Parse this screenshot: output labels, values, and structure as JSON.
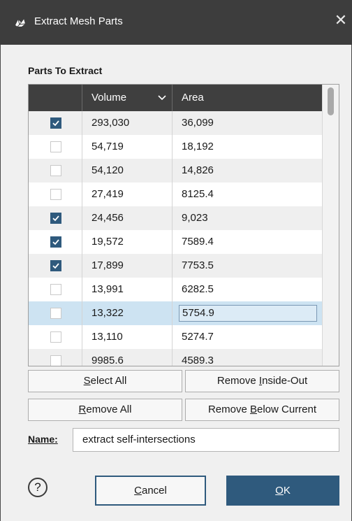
{
  "window": {
    "title": "Extract Mesh Parts",
    "close_glyph": "✕"
  },
  "section": {
    "label": "Parts To Extract"
  },
  "table": {
    "columns": {
      "volume": "Volume",
      "area": "Area"
    },
    "sort": "descending",
    "rows": [
      {
        "checked": true,
        "volume": "293,030",
        "area": "36,099"
      },
      {
        "checked": false,
        "volume": "54,719",
        "area": "18,192"
      },
      {
        "checked": false,
        "volume": "54,120",
        "area": "14,826"
      },
      {
        "checked": false,
        "volume": "27,419",
        "area": "8125.4"
      },
      {
        "checked": true,
        "volume": "24,456",
        "area": "9,023"
      },
      {
        "checked": true,
        "volume": "19,572",
        "area": "7589.4"
      },
      {
        "checked": true,
        "volume": "17,899",
        "area": "7753.5"
      },
      {
        "checked": false,
        "volume": "13,991",
        "area": "6282.5"
      },
      {
        "checked": false,
        "volume": "13,322",
        "area": "5754.9",
        "selected": true
      },
      {
        "checked": false,
        "volume": "13,110",
        "area": "5274.7"
      },
      {
        "checked": false,
        "volume": "9985.6",
        "area": "4589.3"
      }
    ]
  },
  "buttons": {
    "select_all": {
      "pre": "",
      "key": "S",
      "post": "elect All"
    },
    "remove_inside_out": {
      "pre": "Remove ",
      "key": "I",
      "post": "nside-Out"
    },
    "remove_all": {
      "pre": "",
      "key": "R",
      "post": "emove All"
    },
    "remove_below_current": {
      "pre": "Remove ",
      "key": "B",
      "post": "elow Current"
    }
  },
  "name": {
    "label": "Name:",
    "value": "extract self-intersections"
  },
  "footer": {
    "help_glyph": "?",
    "cancel": {
      "key": "C",
      "post": "ancel"
    },
    "ok": {
      "key": "O",
      "post": "K"
    }
  },
  "colors": {
    "accent": "#2f5a7d",
    "titlebar": "#3d3d3d",
    "header": "#3f3f3f",
    "selected_row": "#cde3f2"
  },
  "icons": {
    "app": "mesh-app-icon",
    "close": "close-icon",
    "sort": "chevron-down-icon",
    "check": "checkmark-icon",
    "help": "help-icon"
  }
}
